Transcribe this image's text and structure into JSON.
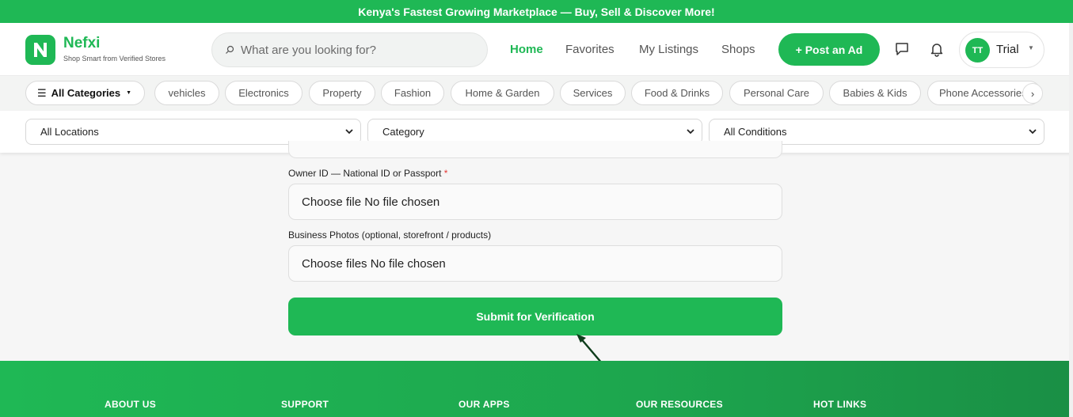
{
  "promo_banner": "Kenya's Fastest Growing Marketplace — Buy, Sell & Discover More!",
  "brand": {
    "name": "Nefxi",
    "tagline": "Shop Smart from Verified Stores",
    "logo_letter": "N",
    "color": "#1fb855"
  },
  "search": {
    "placeholder": "What are you looking for?"
  },
  "nav": {
    "home": "Home",
    "favorites": "Favorites",
    "my_listings": "My Listings",
    "shops": "Shops"
  },
  "post_ad_label": "+ Post an Ad",
  "user": {
    "initials": "TT",
    "name": "Trial"
  },
  "categories": {
    "all_label": "All Categories",
    "items": [
      "vehicles",
      "Electronics",
      "Property",
      "Fashion",
      "Home & Garden",
      "Services",
      "Food & Drinks",
      "Personal Care",
      "Babies & Kids",
      "Phone Accessories"
    ]
  },
  "filters": {
    "location": "All Locations",
    "category": "Category",
    "condition": "All Conditions"
  },
  "form": {
    "owner_id_label": "Owner ID — National ID or Passport",
    "required_marker": "*",
    "owner_id_value": "Choose file No file chosen",
    "photos_label": "Business Photos (optional, storefront / products)",
    "photos_value": "Choose files No file chosen",
    "submit_label": "Submit for Verification"
  },
  "footer": {
    "columns": [
      "ABOUT US",
      "SUPPORT",
      "OUR APPS",
      "OUR RESOURCES",
      "HOT LINKS"
    ]
  },
  "icons": {
    "chat": "chat-icon",
    "bell": "bell-icon",
    "search": "search-icon"
  }
}
